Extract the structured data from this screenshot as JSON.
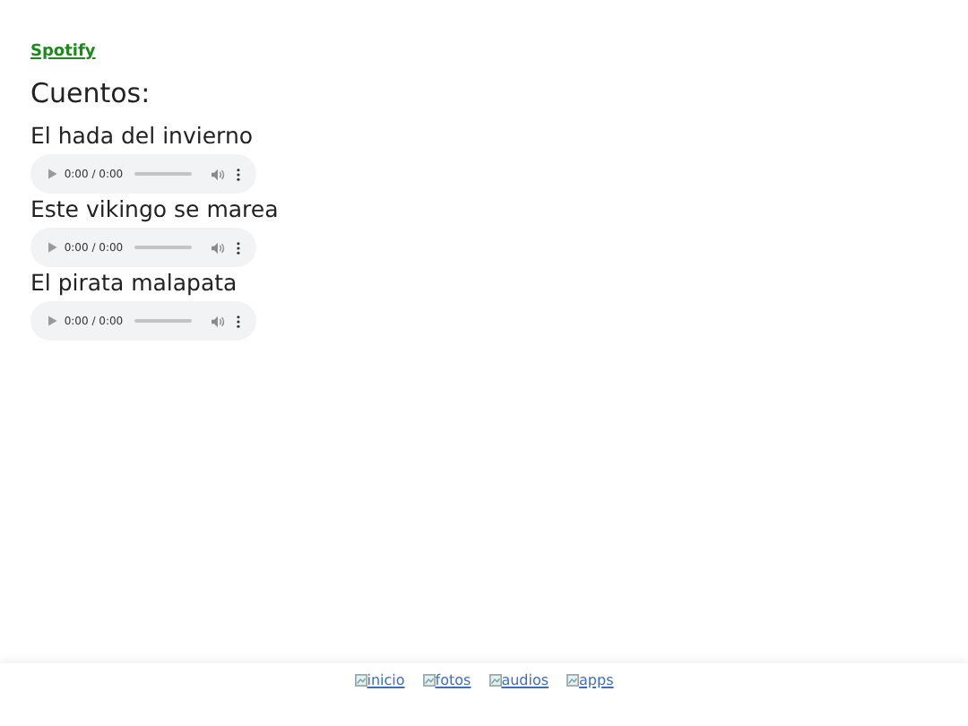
{
  "top_link": "Spotify",
  "heading": "Cuentos:",
  "stories": [
    {
      "title": "El hada del invierno",
      "time": "0:00 / 0:00"
    },
    {
      "title": "Este vikingo se marea",
      "time": "0:00 / 0:00"
    },
    {
      "title": "El pirata malapata",
      "time": "0:00 / 0:00"
    }
  ],
  "footer_links": [
    "inicio",
    "fotos",
    "audios",
    "apps"
  ]
}
